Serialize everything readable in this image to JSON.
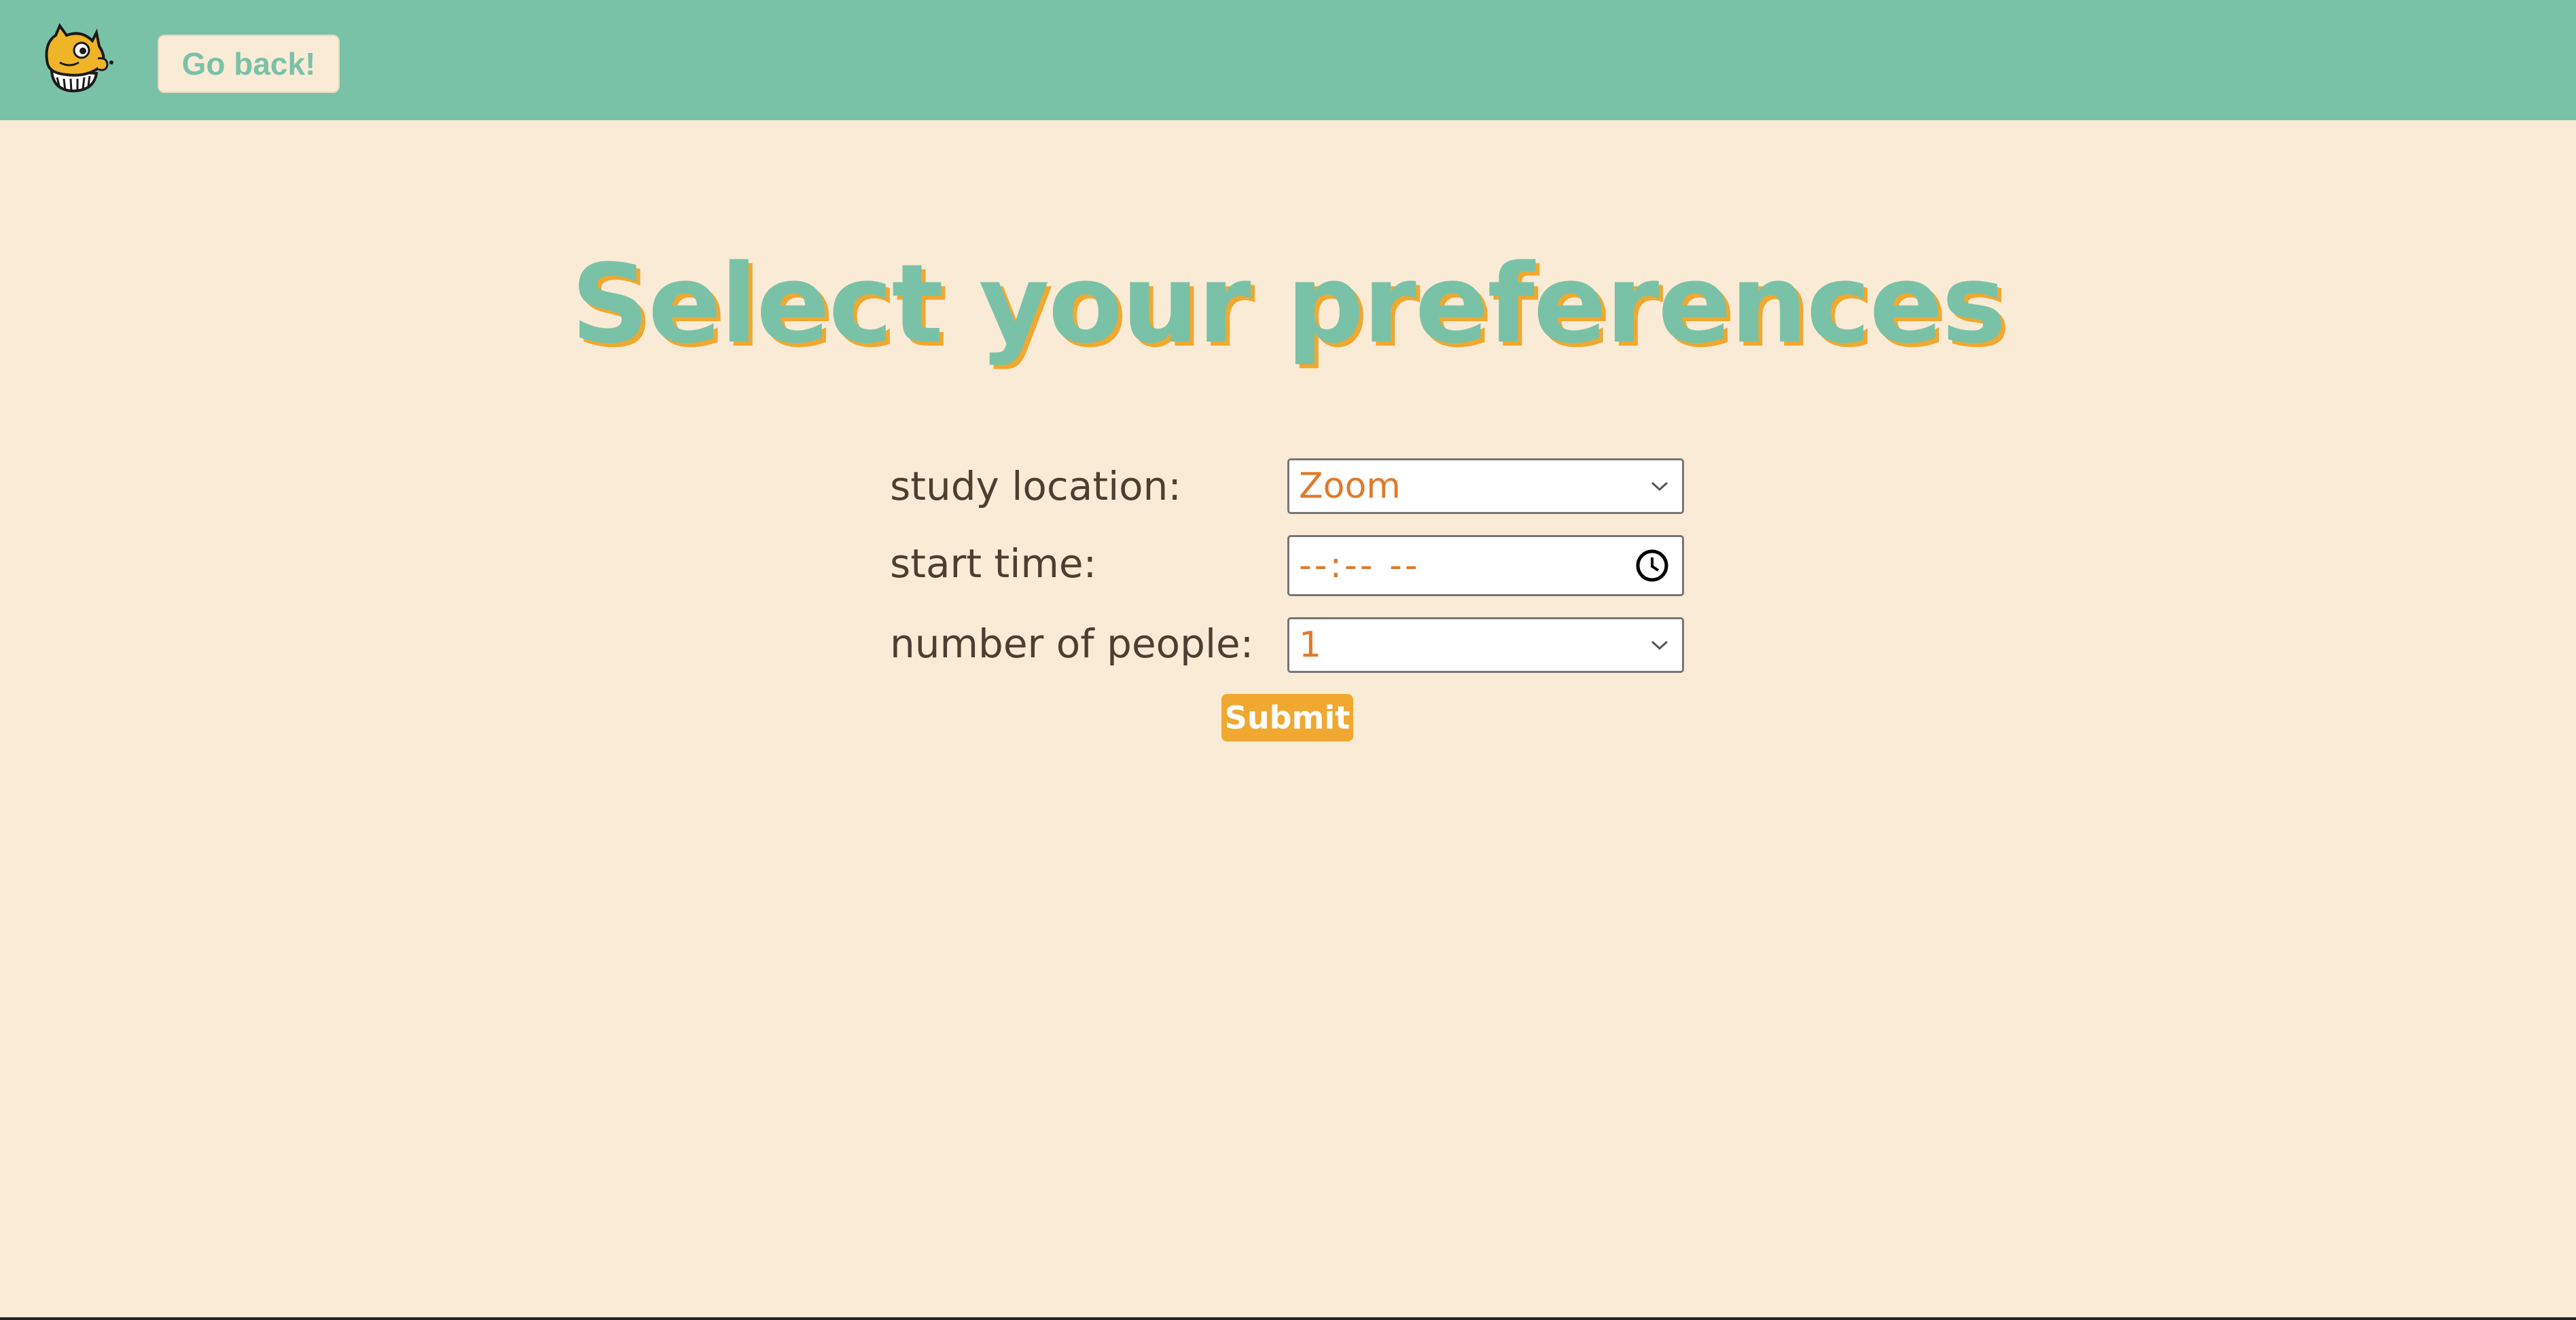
{
  "header": {
    "back_label": "Go back!",
    "logo_icon": "mascot-logo-icon"
  },
  "main": {
    "title": "Select your preferences",
    "form": {
      "location_label": "study location:",
      "location_value": "Zoom",
      "start_time_label": "start time:",
      "start_time_placeholder": "--:-- --",
      "people_label": "number of people:",
      "people_value": "1",
      "submit_label": "Submit"
    }
  },
  "colors": {
    "header_bg": "#79C2A8",
    "page_bg": "#FAEBD7",
    "title": "#79C2A8",
    "title_shadow": "#F0A830",
    "accent": "#F0A830",
    "field_text": "#E07A2C",
    "label_text": "#4D3E30"
  }
}
